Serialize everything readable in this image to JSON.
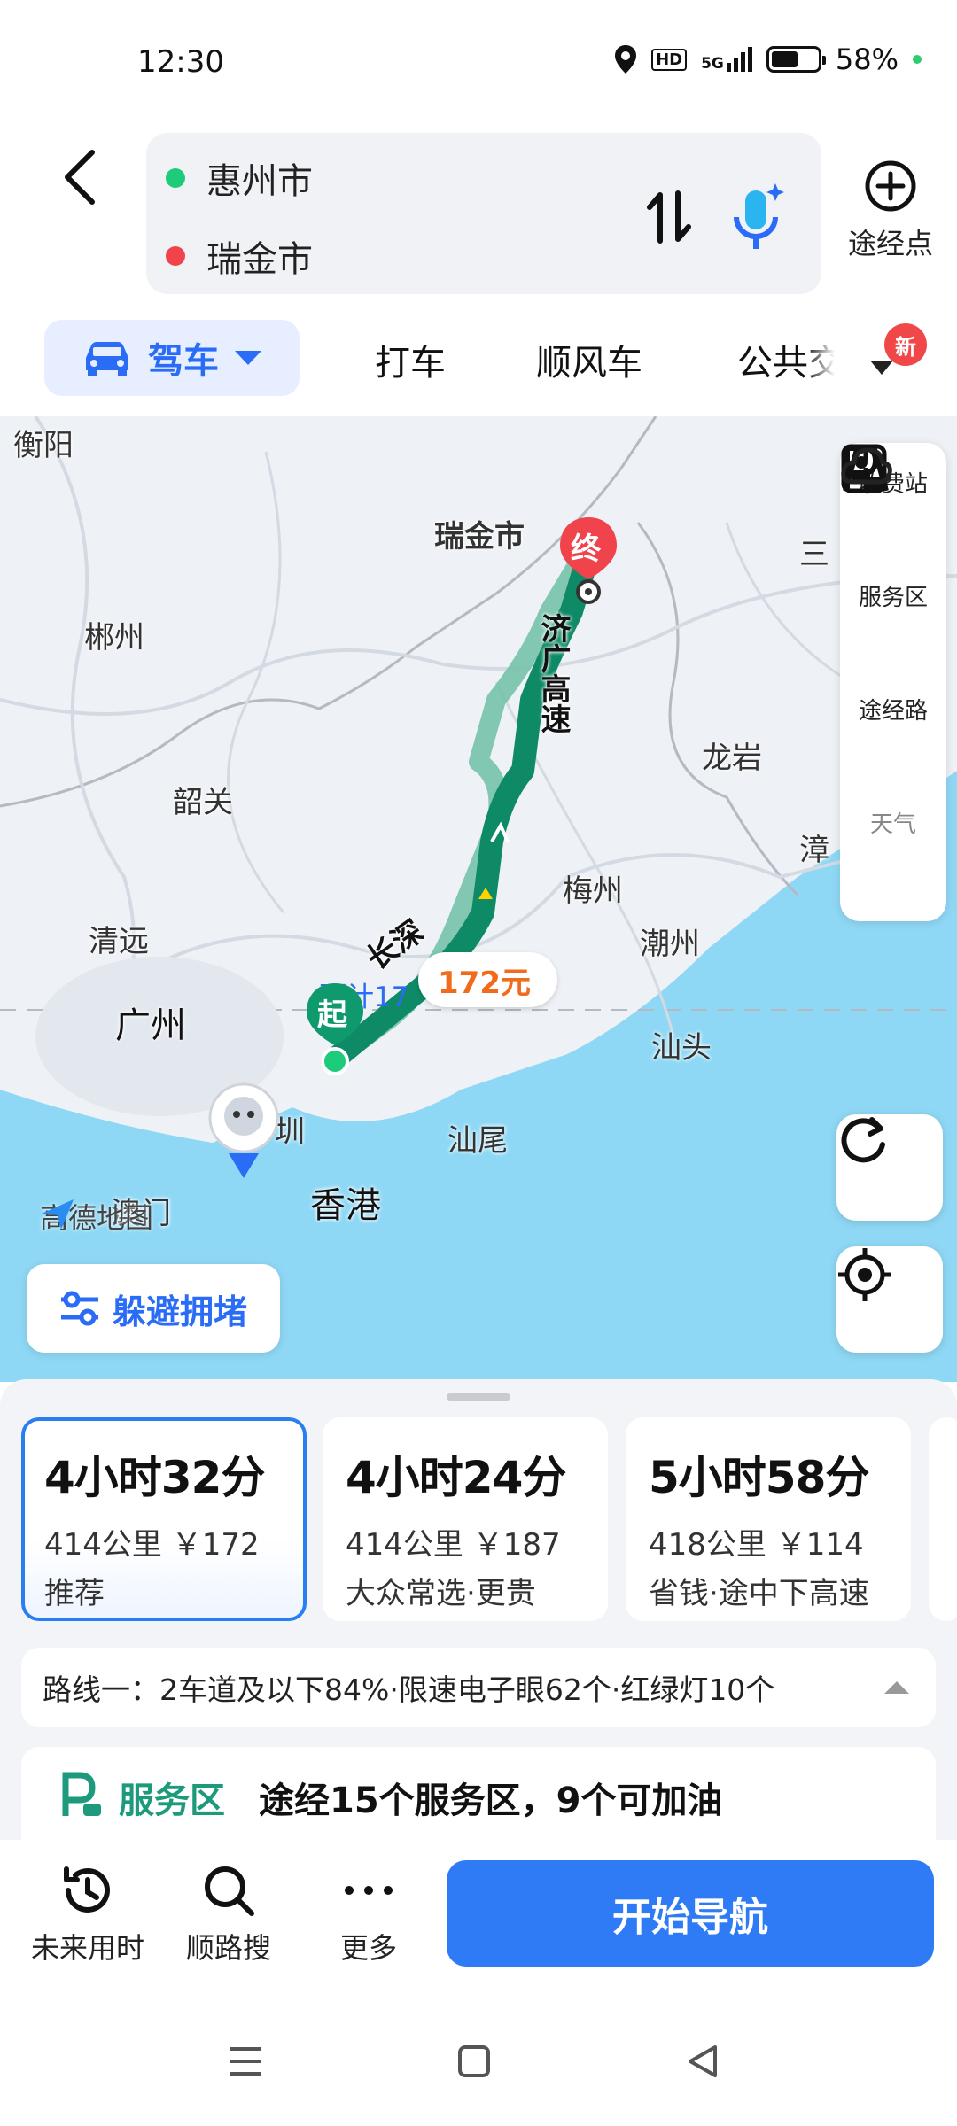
{
  "status_bar": {
    "time": "12:30",
    "network": "5G",
    "battery": "58%",
    "battery_level": 0.58
  },
  "header": {
    "origin": "惠州市",
    "destination": "瑞金市",
    "waypoint_label": "途经点"
  },
  "modes": {
    "drive": "驾车",
    "taxi": "打车",
    "carpool": "顺风车",
    "transit": "公共交",
    "new_badge": "新"
  },
  "map": {
    "labels": {
      "hengyang": "衡阳",
      "chenzhou": "郴州",
      "shaoguan": "韶关",
      "qingyuan": "清远",
      "guangzhou": "广州",
      "shenzhen": "圳",
      "aomen": "澳门",
      "xianggang": "香港",
      "shanwei": "汕尾",
      "shantou": "汕头",
      "chaozhou": "潮州",
      "meizhou": "梅州",
      "longyan": "龙岩",
      "zhangzhou": "漳",
      "sanming": "三",
      "ruijin": "瑞金市"
    },
    "route_labels": {
      "jiguang": "济广高速",
      "changshen": "长深"
    },
    "price_bubble": "172元",
    "estimate_text": "预计17",
    "start_marker": "起",
    "end_marker": "终",
    "watermark": "高德地图",
    "avoid_button": "躲避拥堵",
    "tools": {
      "toll": "收费站",
      "service": "服务区",
      "waypoint_road": "途经路",
      "weather": "天气"
    },
    "colors": {
      "route_selected": "#0f8a66",
      "route_alt": "#6fbfa4",
      "sea": "#8fd8f5",
      "origin": "#1ecb7a",
      "destination": "#f0434b"
    }
  },
  "routes": [
    {
      "time": "4小时32分",
      "meta": "414公里 ￥172",
      "tag": "推荐",
      "selected": true
    },
    {
      "time": "4小时24分",
      "meta": "414公里 ￥187",
      "tag": "大众常选·更贵",
      "selected": false
    },
    {
      "time": "5小时58分",
      "meta": "418公里 ￥114",
      "tag": "省钱·途中下高速",
      "selected": false
    }
  ],
  "route_detail": "路线一：2车道及以下84%·限速电子眼62个·红绿灯10个",
  "service_area": {
    "title": "服务区",
    "text": "途经15个服务区，9个可加油"
  },
  "actions": {
    "future_time": "未来用时",
    "along_search": "顺路搜",
    "more": "更多",
    "start_nav": "开始导航"
  }
}
